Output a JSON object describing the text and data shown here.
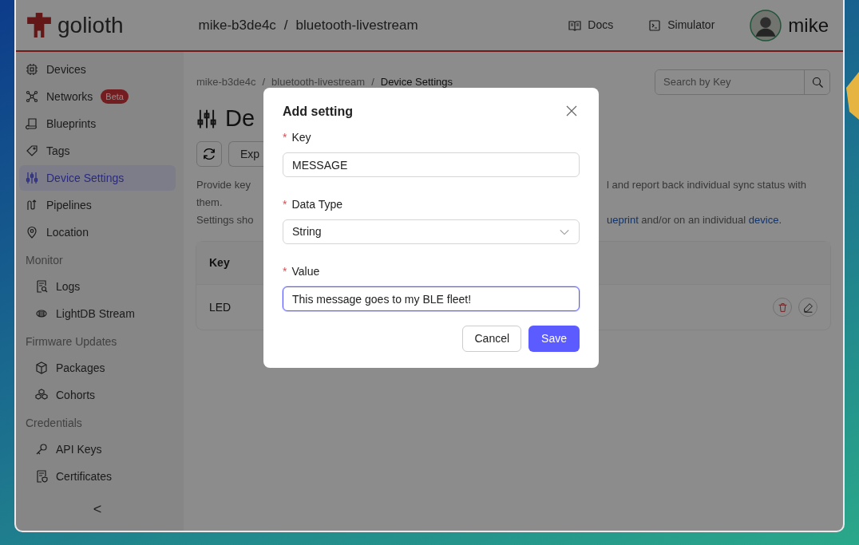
{
  "header": {
    "logo_text": "golioth",
    "project_path": [
      "mike-b3de4c",
      "/",
      "bluetooth-livestream"
    ],
    "links": [
      {
        "label": "Docs"
      },
      {
        "label": "Simulator"
      }
    ],
    "user": {
      "name": "mike"
    }
  },
  "sidebar": {
    "items": [
      {
        "kind": "link",
        "label": "Devices",
        "selected": false
      },
      {
        "kind": "link",
        "label": "Networks",
        "badge": "Beta",
        "selected": false
      },
      {
        "kind": "link",
        "label": "Blueprints",
        "selected": false
      },
      {
        "kind": "link",
        "label": "Tags",
        "selected": false
      },
      {
        "kind": "link",
        "label": "Device Settings",
        "selected": true
      },
      {
        "kind": "link",
        "label": "Pipelines",
        "selected": false
      },
      {
        "kind": "link",
        "label": "Location",
        "selected": false
      },
      {
        "kind": "section",
        "label": "Monitor",
        "children": [
          {
            "label": "Logs",
            "selected": false
          },
          {
            "label": "LightDB Stream",
            "selected": false
          }
        ]
      },
      {
        "kind": "section",
        "label": "Firmware Updates",
        "children": [
          {
            "label": "Packages",
            "selected": false
          },
          {
            "label": "Cohorts",
            "selected": false
          }
        ]
      },
      {
        "kind": "section",
        "label": "Credentials",
        "children": [
          {
            "label": "API Keys",
            "selected": false
          },
          {
            "label": "Certificates",
            "selected": false
          }
        ]
      }
    ],
    "collapse": "<"
  },
  "main": {
    "breadcrumb": [
      "mike-b3de4c",
      "/",
      "bluetooth-livestream",
      "/",
      "Device Settings"
    ],
    "search": {
      "placeholder": "Search by Key"
    },
    "title": "De",
    "toolbar_button": "Exp",
    "description": [
      {
        "left": "Provide key",
        "right": [
          {
            "text": "l and report back individual sync status with",
            "link": false
          }
        ]
      },
      {
        "left": "them."
      },
      {
        "left": "Settings sho",
        "right": [
          {
            "text": "ueprint",
            "link": true
          },
          {
            "text": " and/or on an individual ",
            "link": false
          },
          {
            "text": "device",
            "link": true
          },
          {
            "text": ".",
            "link": false
          }
        ]
      }
    ],
    "table": {
      "columns": [
        "Key"
      ],
      "rows": [
        {
          "key": "LED"
        }
      ]
    }
  },
  "modal": {
    "title": "Add setting",
    "fields": [
      {
        "kind": "text",
        "required_mark": "*",
        "label": "Key",
        "value": "MESSAGE",
        "focused": false
      },
      {
        "kind": "select",
        "required_mark": "*",
        "label": "Data Type",
        "value": "String",
        "focused": false
      },
      {
        "kind": "text",
        "required_mark": "*",
        "label": "Value",
        "value": "This message goes to my BLE fleet!",
        "focused": true
      }
    ],
    "buttons": [
      {
        "label": "Cancel",
        "kind": "secondary"
      },
      {
        "label": "Save",
        "kind": "primary"
      }
    ]
  }
}
